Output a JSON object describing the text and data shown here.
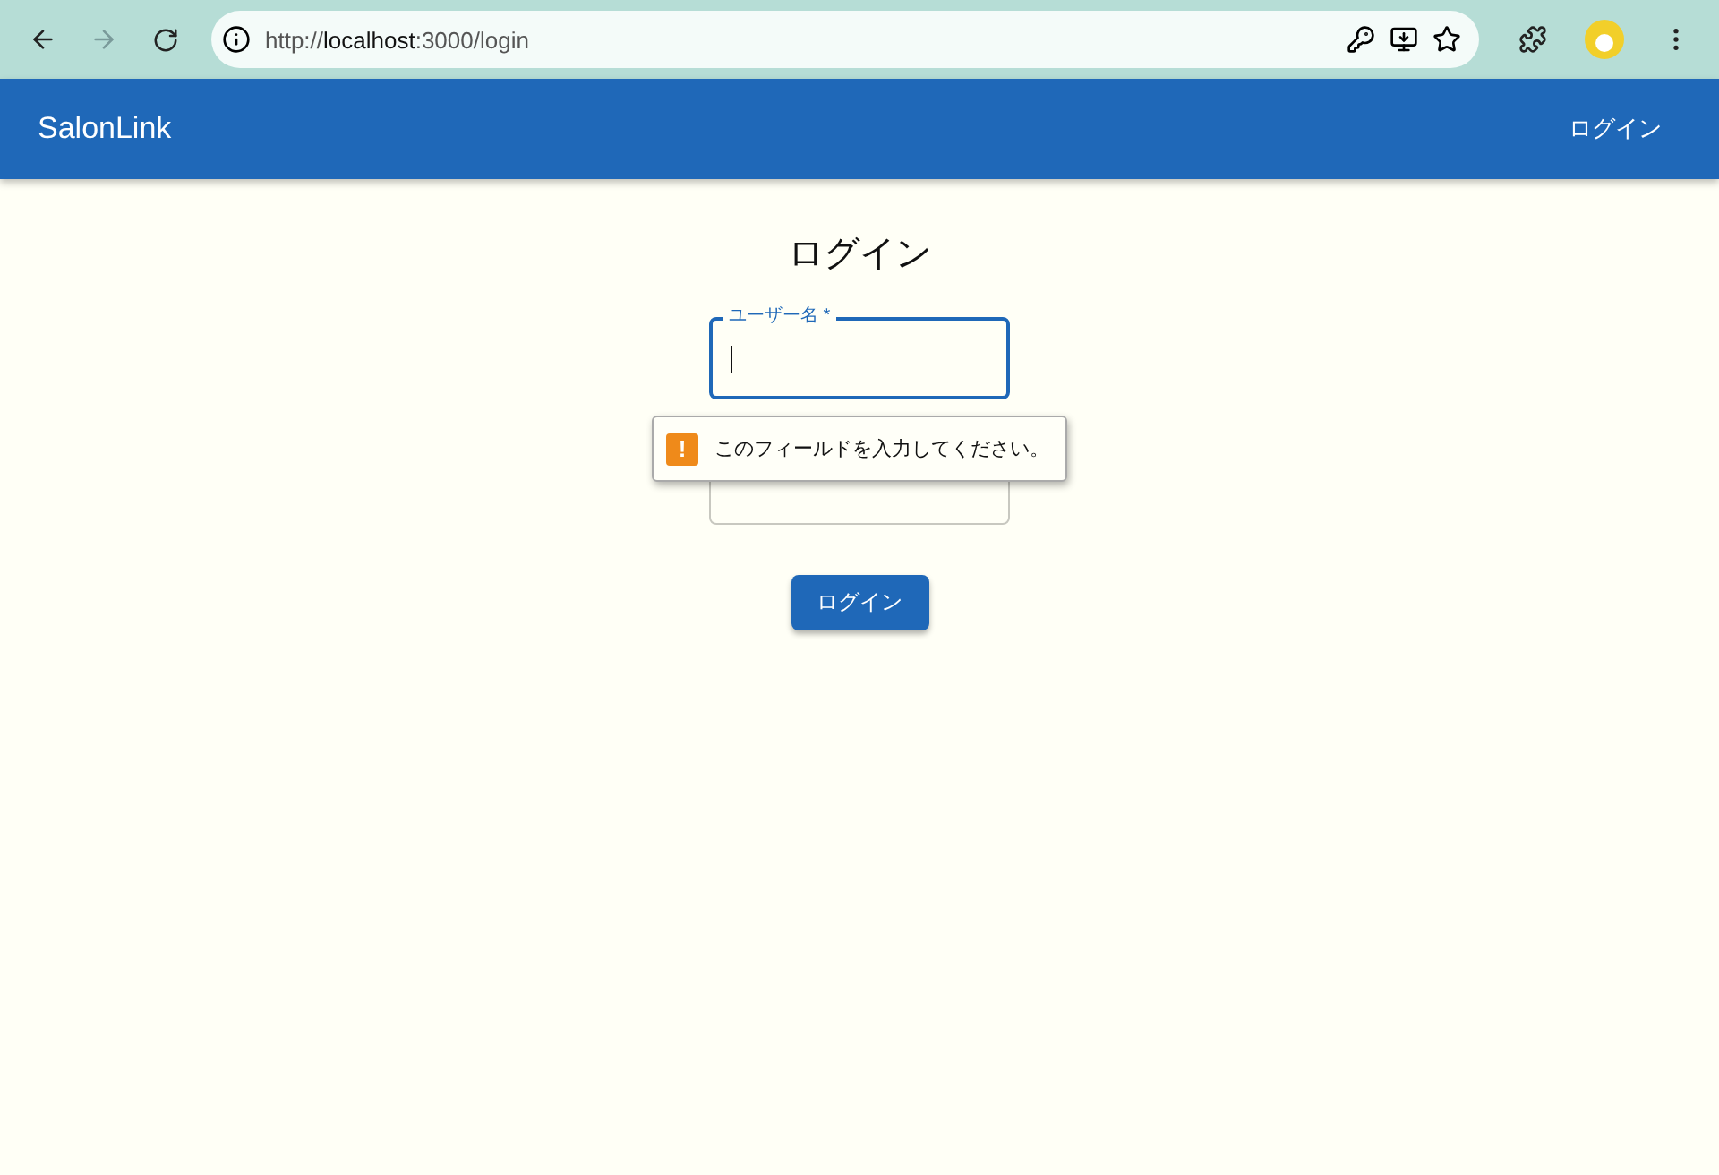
{
  "browser": {
    "url_prefix": "http://",
    "url_host": "localhost",
    "url_rest": ":3000/login"
  },
  "app_bar": {
    "brand": "SalonLink",
    "nav_link": "ログイン"
  },
  "form": {
    "title": "ログイン",
    "username": {
      "label": "ユーザー名",
      "required_mark": "*",
      "focused": true
    },
    "validation_tooltip": {
      "message": "このフィールドを入力してください。",
      "warning_mark": "!"
    },
    "submit": "ログイン"
  }
}
